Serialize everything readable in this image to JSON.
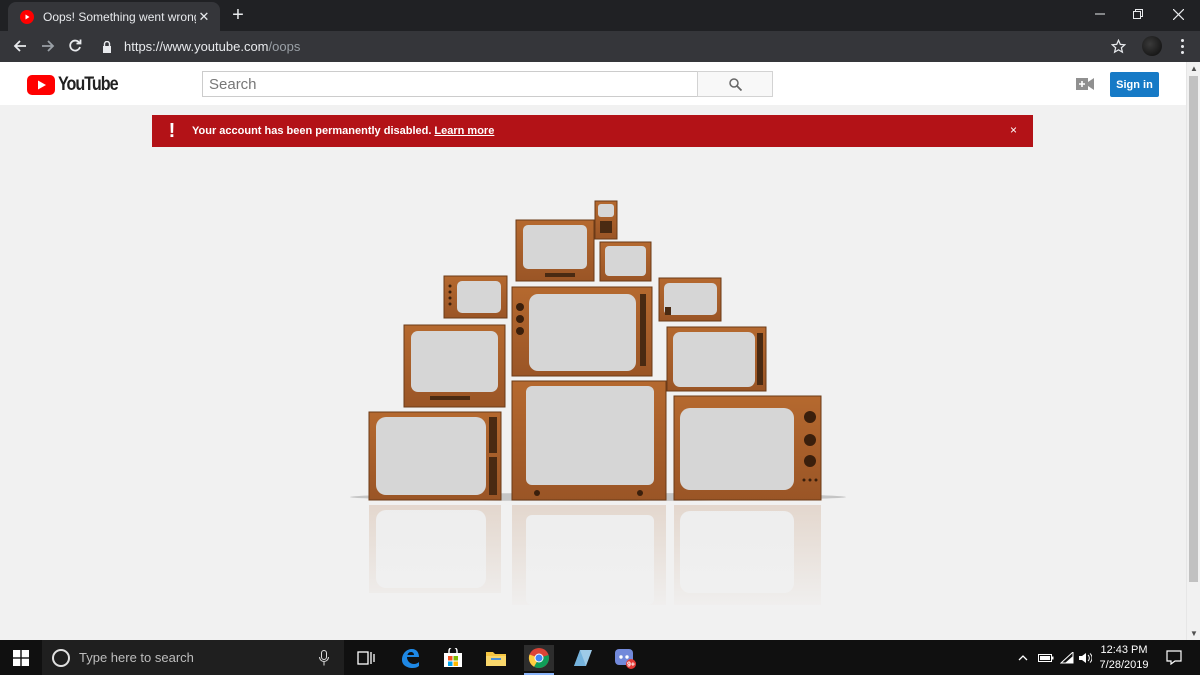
{
  "browser": {
    "tab_title": "Oops! Something went wrong. -",
    "tab_close": "✕",
    "new_tab": "+",
    "url_host": "https://www.youtube.com",
    "url_path": "/oops"
  },
  "youtube": {
    "logo_text": "YouTube",
    "search_placeholder": "Search",
    "signin_label": "Sign in"
  },
  "alert": {
    "icon": "!",
    "message": "Your account has been permanently disabled.",
    "link": "Learn more",
    "close": "×"
  },
  "taskbar": {
    "search_placeholder": "Type here to search",
    "time": "12:43 PM",
    "date": "7/28/2019",
    "badge": "9+"
  },
  "colors": {
    "chrome_frame": "#202124",
    "chrome_toolbar": "#35363a",
    "youtube_red": "#ff0000",
    "alert_red": "#b31217",
    "signin_blue": "#167ac6",
    "tv_wood": "#a9602c"
  },
  "icons": [
    "youtube-favicon",
    "back-arrow-icon",
    "forward-arrow-icon",
    "reload-icon",
    "lock-icon",
    "bookmark-star-icon",
    "profile-avatar",
    "chrome-menu-icon",
    "search-icon",
    "video-upload-icon",
    "windows-start-icon",
    "microphone-icon",
    "task-view-icon",
    "edge-icon",
    "store-icon",
    "file-explorer-icon",
    "chrome-icon",
    "app-icon",
    "discord-icon",
    "tray-chevron-icon",
    "battery-icon",
    "wifi-icon",
    "volume-icon",
    "notification-icon"
  ]
}
